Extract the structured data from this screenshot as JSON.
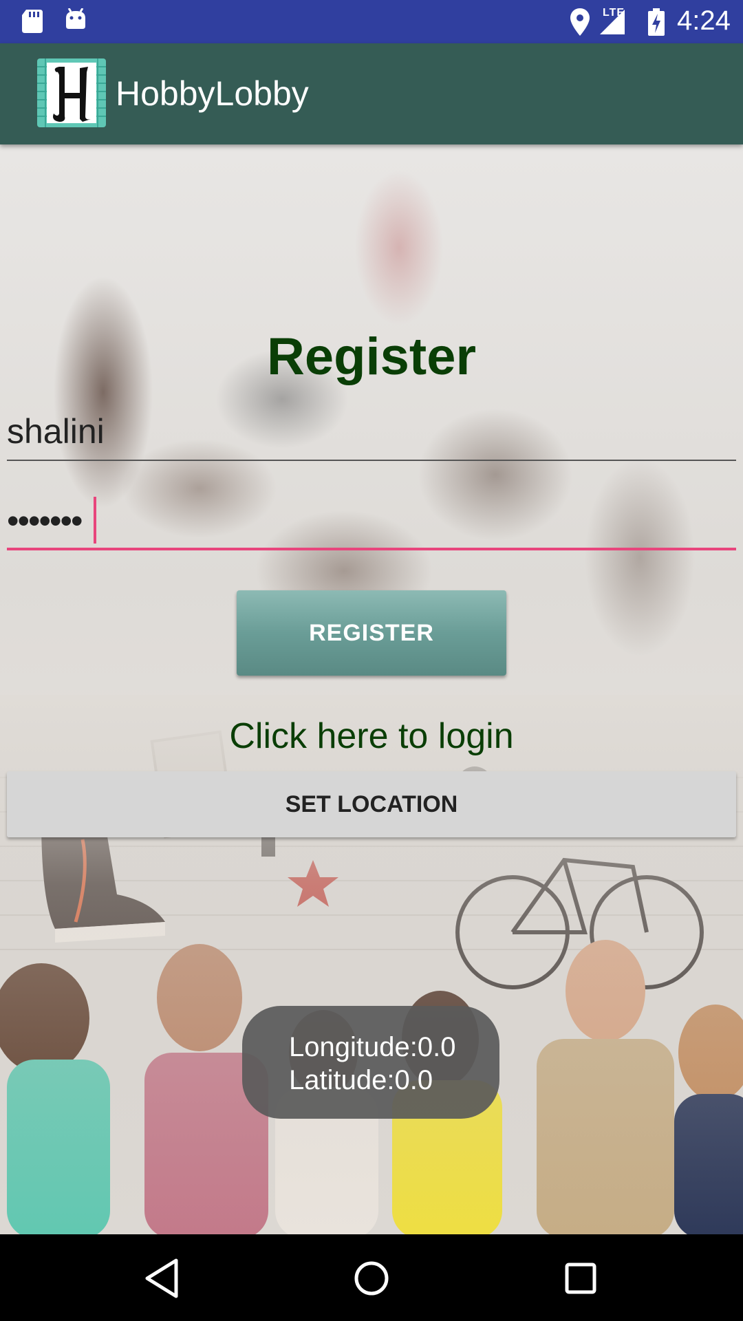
{
  "status_bar": {
    "network_label": "LTE",
    "time": "4:24",
    "icons": [
      "sd-card-icon",
      "android-icon",
      "location-icon",
      "signal-icon",
      "battery-charging-icon"
    ]
  },
  "toolbar": {
    "title": "HobbyLobby",
    "logo_icon": "hobbylobby-logo-icon"
  },
  "form": {
    "heading": "Register",
    "username_value": "shalini",
    "password_value": "•••••••",
    "register_button": "REGISTER",
    "login_link": "Click here to login",
    "set_location_button": "SET LOCATION"
  },
  "toast": {
    "longitude": "Longitude:0.0",
    "latitude": "Latitude:0.0"
  },
  "colors": {
    "status_bar": "#303F9F",
    "toolbar": "#355C55",
    "heading": "#0A3E06",
    "accent": "#E8457C",
    "register_button": "#6a9d97"
  },
  "nav_bar": {
    "icons": [
      "back-icon",
      "home-icon",
      "recents-icon"
    ]
  }
}
